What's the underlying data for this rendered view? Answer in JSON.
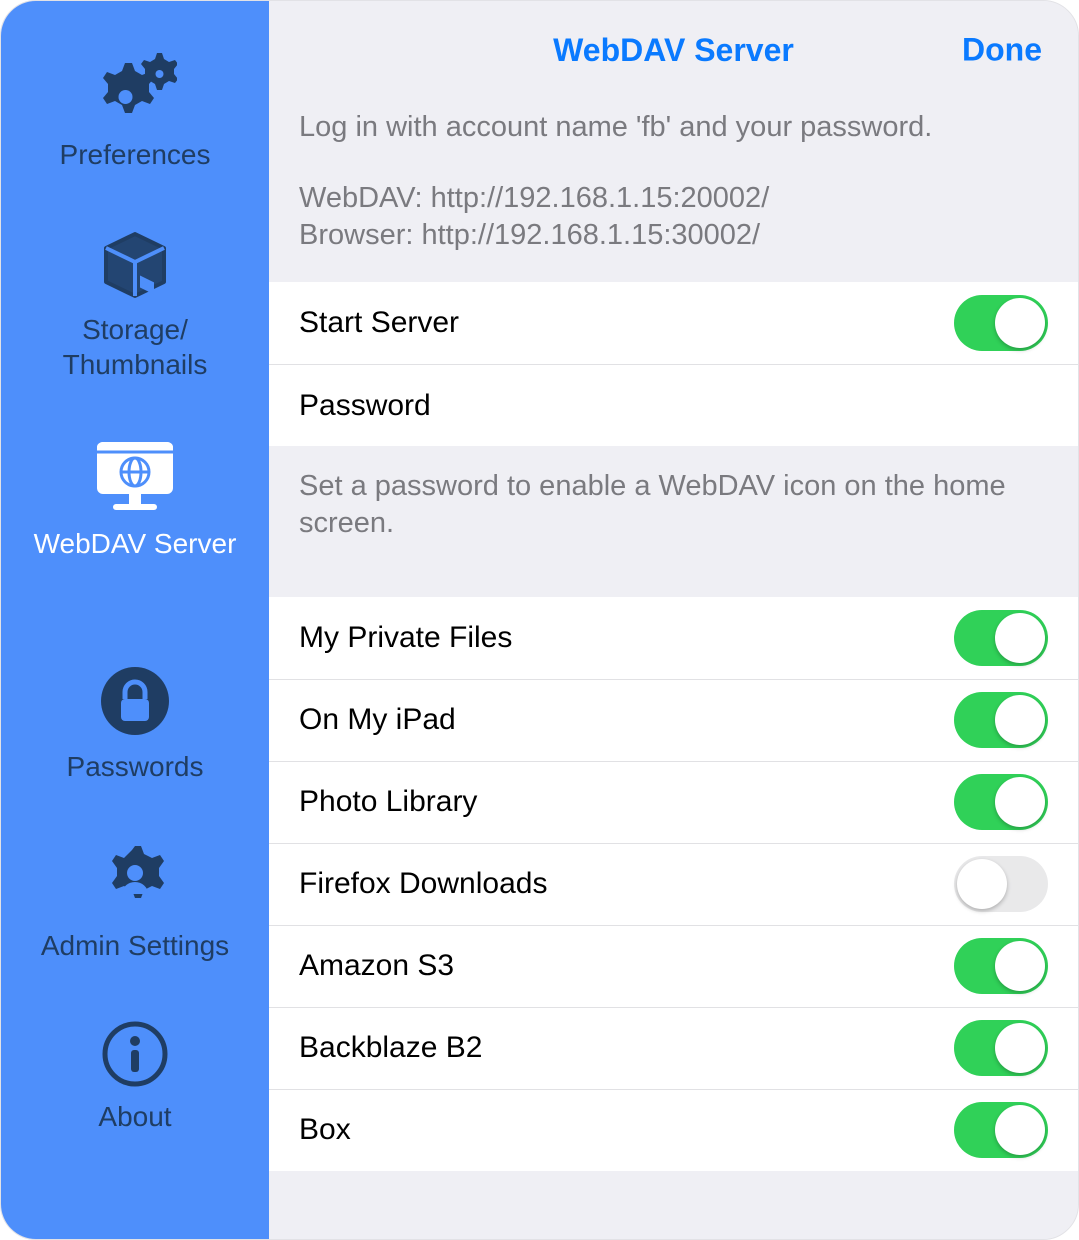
{
  "navbar": {
    "title": "WebDAV Server",
    "done": "Done"
  },
  "sidebar": {
    "items": [
      {
        "key": "preferences",
        "label": "Preferences",
        "icon": "gears-icon",
        "active": false
      },
      {
        "key": "storage",
        "label": "Storage/\nThumbnails",
        "icon": "package-icon",
        "active": false
      },
      {
        "key": "webdav",
        "label": "WebDAV Server",
        "icon": "server-icon",
        "active": true
      },
      {
        "key": "passwords",
        "label": "Passwords",
        "icon": "lock-icon",
        "active": false
      },
      {
        "key": "admin",
        "label": "Admin Settings",
        "icon": "usergear-icon",
        "active": false
      },
      {
        "key": "about",
        "label": "About",
        "icon": "info-icon",
        "active": false
      }
    ]
  },
  "info": {
    "login_line": "Log in with account name 'fb' and your password.",
    "webdav_line": "WebDAV: http://192.168.1.15:20002/",
    "browser_line": "Browser: http://192.168.1.15:30002/"
  },
  "server_section": {
    "start_server_label": "Start Server",
    "start_server_on": true,
    "password_label": "Password"
  },
  "footer_note": "Set a password to enable a WebDAV icon on the home screen.",
  "shares": [
    {
      "label": "My Private Files",
      "on": true
    },
    {
      "label": "On My iPad",
      "on": true
    },
    {
      "label": "Photo Library",
      "on": true
    },
    {
      "label": "Firefox Downloads",
      "on": false
    },
    {
      "label": "Amazon S3",
      "on": true
    },
    {
      "label": "Backblaze B2",
      "on": true
    },
    {
      "label": "Box",
      "on": true
    }
  ]
}
